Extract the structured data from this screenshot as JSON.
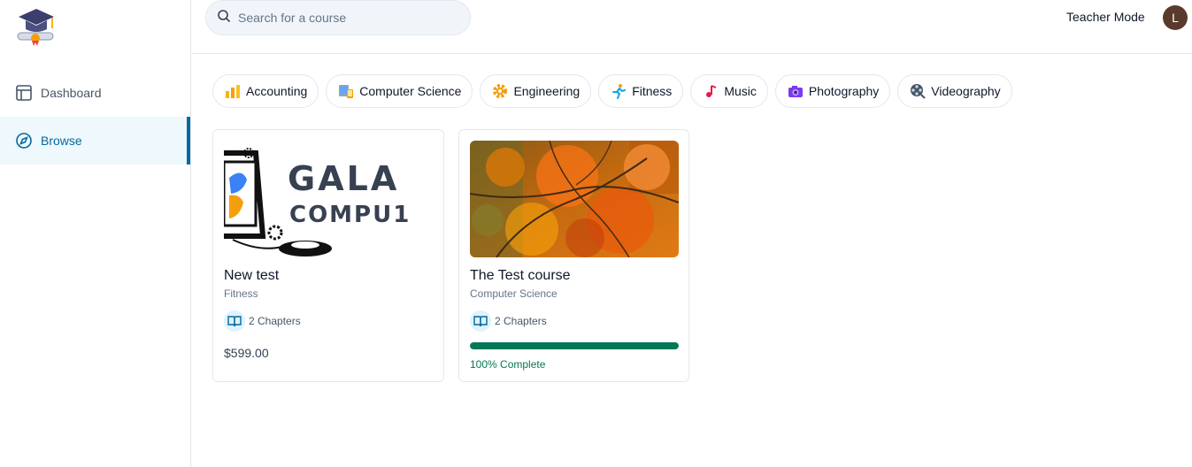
{
  "sidebar": {
    "logo_icon": "graduation-cap-icon",
    "items": [
      {
        "label": "Dashboard",
        "icon": "layout-icon",
        "active": false
      },
      {
        "label": "Browse",
        "icon": "compass-icon",
        "active": true
      }
    ]
  },
  "header": {
    "search": {
      "placeholder": "Search for a course",
      "value": ""
    },
    "teacher_mode_label": "Teacher Mode",
    "avatar_initial": "L"
  },
  "categories": [
    {
      "label": "Accounting",
      "icon": "bar-chart-icon"
    },
    {
      "label": "Computer Science",
      "icon": "devices-icon"
    },
    {
      "label": "Engineering",
      "icon": "gear-icon"
    },
    {
      "label": "Fitness",
      "icon": "running-icon"
    },
    {
      "label": "Music",
      "icon": "music-note-icon"
    },
    {
      "label": "Photography",
      "icon": "camera-icon"
    },
    {
      "label": "Videography",
      "icon": "film-reel-icon"
    }
  ],
  "courses": [
    {
      "title": "New test",
      "category": "Fitness",
      "chapters": "2 Chapters",
      "price": "$599.00",
      "thumbnail": "galaxy-computer-logo-image",
      "thumb_text_1": "GALA",
      "thumb_text_2": "COMPU1"
    },
    {
      "title": "The Test course",
      "category": "Computer Science",
      "chapters": "2 Chapters",
      "progress": 1.0,
      "progress_label": "100% Complete",
      "thumbnail": "autumn-tree-image"
    }
  ],
  "colors": {
    "accent": "#0369a1",
    "active_bg": "#eff8fc",
    "progress": "#047857"
  }
}
